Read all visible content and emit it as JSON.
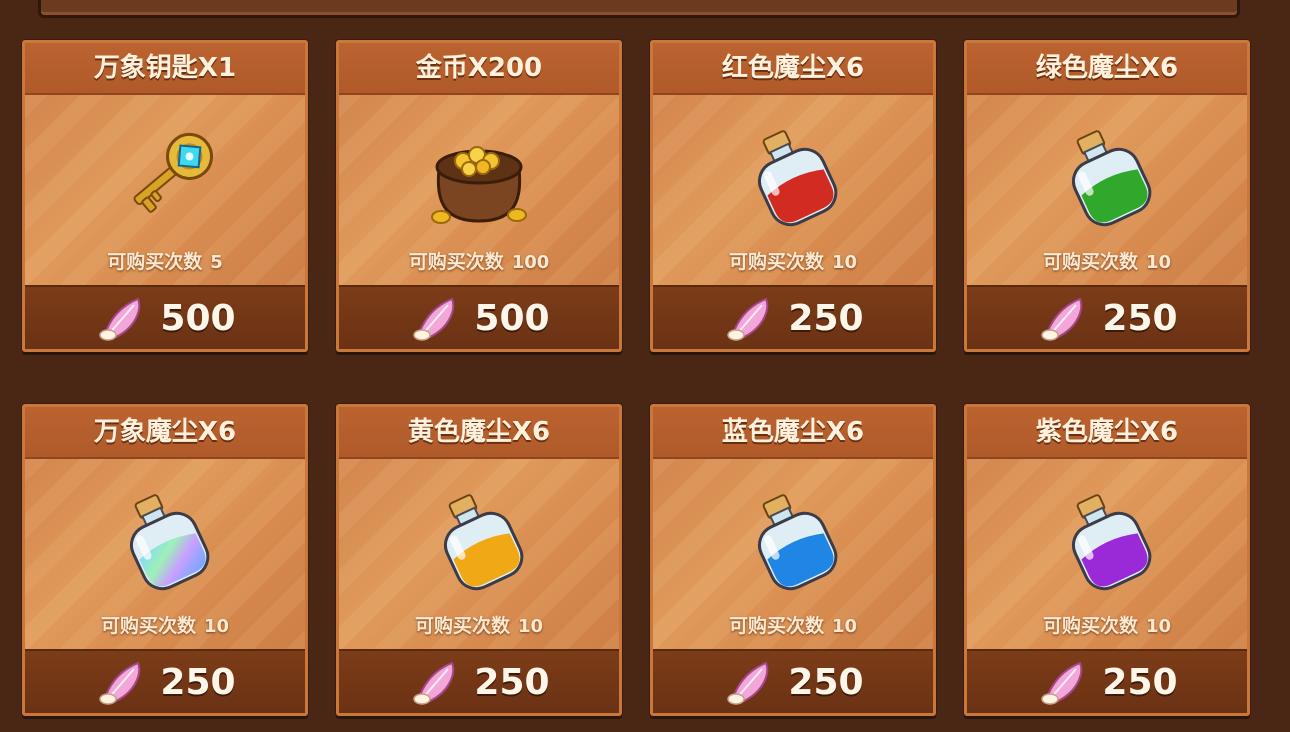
{
  "shop": {
    "items": [
      {
        "title": "万象钥匙X1",
        "limit_label": "可购买次数",
        "limit_count": "5",
        "price": "500",
        "icon": "golden-key-icon"
      },
      {
        "title": "金币X200",
        "limit_label": "可购买次数",
        "limit_count": "100",
        "price": "500",
        "icon": "coin-bag-icon"
      },
      {
        "title": "红色魔尘X6",
        "limit_label": "可购买次数",
        "limit_count": "10",
        "price": "250",
        "icon": "red-dust-bottle-icon"
      },
      {
        "title": "绿色魔尘X6",
        "limit_label": "可购买次数",
        "limit_count": "10",
        "price": "250",
        "icon": "green-dust-bottle-icon"
      },
      {
        "title": "万象魔尘X6",
        "limit_label": "可购买次数",
        "limit_count": "10",
        "price": "250",
        "icon": "rainbow-dust-bottle-icon"
      },
      {
        "title": "黄色魔尘X6",
        "limit_label": "可购买次数",
        "limit_count": "10",
        "price": "250",
        "icon": "yellow-dust-bottle-icon"
      },
      {
        "title": "蓝色魔尘X6",
        "limit_label": "可购买次数",
        "limit_count": "10",
        "price": "250",
        "icon": "blue-dust-bottle-icon"
      },
      {
        "title": "紫色魔尘X6",
        "limit_label": "可购买次数",
        "limit_count": "10",
        "price": "250",
        "icon": "purple-dust-bottle-icon"
      }
    ],
    "currency_icon": "pink-feather-icon"
  },
  "colors": {
    "panel_bg": "#4a2715",
    "card_border": "#c9773a",
    "price_bar": "#6a3214",
    "red_dust": "#d22b22",
    "green_dust": "#2fa82b",
    "yellow_dust": "#f0a814",
    "blue_dust": "#1f86e6",
    "purple_dust": "#9a2ad8"
  }
}
